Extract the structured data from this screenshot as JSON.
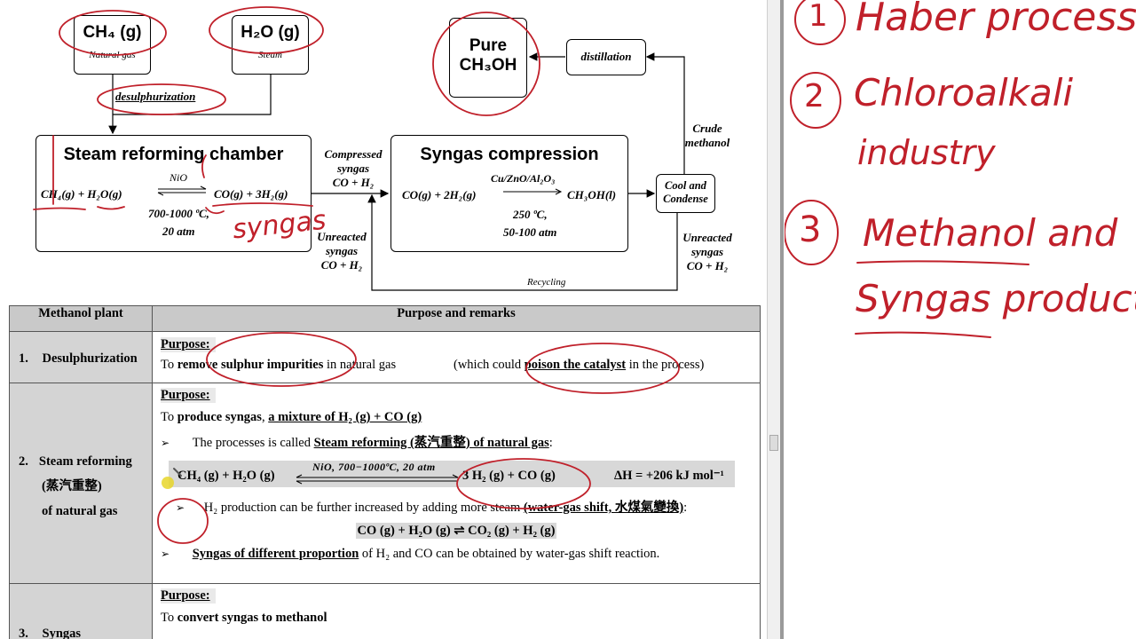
{
  "diagram": {
    "ch4_formula": "CH₄ (g)",
    "ch4_sub": "Natural gas",
    "h2o_formula": "H₂O (g)",
    "h2o_sub": "Steam",
    "desulph": "desulphurization",
    "steam_title": "Steam reforming chamber",
    "steam_catalyst": "NiO",
    "steam_left": "CH₄(g) + H₂O(g)",
    "steam_right": "CO(g) + 3H₂(g)",
    "steam_cond1": "700-1000 ºC,",
    "steam_cond2": "20 atm",
    "compressed1": "Compressed",
    "compressed2": "syngas",
    "compressed3": "CO + H₂",
    "unreacted_l1": "Unreacted",
    "unreacted_l2": "syngas",
    "unreacted_l3": "CO + H₂",
    "syngas_title": "Syngas compression",
    "syngas_catalyst": "Cu/ZnO/Al₂O₃",
    "syngas_left": "CO(g) + 2H₂(g)",
    "syngas_right": "CH₃OH(l)",
    "syngas_cond1": "250 ºC,",
    "syngas_cond2": "50-100 atm",
    "pure1": "Pure",
    "pure2": "CH₃OH",
    "distillation": "distillation",
    "crude1": "Crude",
    "crude2": "methanol",
    "cool1": "Cool and",
    "cool2": "Condense",
    "unreacted_r1": "Unreacted",
    "unreacted_r2": "syngas",
    "unreacted_r3": "CO + H₂",
    "recycling": "Recycling"
  },
  "table": {
    "head_left": "Methanol plant",
    "head_right": "Purpose and remarks",
    "r1_num": "1.",
    "r1_name": "Desulphurization",
    "r1_purpose": "Purpose:",
    "r1_to": "To ",
    "r1_bold": "remove sulphur impurities",
    "r1_rest": " in natural gas",
    "r1_paren_a": "(which could ",
    "r1_paren_b": "poison the catalyst",
    "r1_paren_c": " in the process)",
    "r2_num": "2.",
    "r2_name1": "Steam reforming",
    "r2_name2": "(蒸汽重整)",
    "r2_name3": "of natural gas",
    "r2_purpose": "Purpose:",
    "r2_to": "To ",
    "r2_bold1": "produce syngas",
    "r2_comma": ", ",
    "r2_bold2": "a mixture of H₂ (g) + CO (g)",
    "r2_b1_pre": "The processes is called ",
    "r2_b1_bold": "Steam reforming (蒸汽重整) of natural gas",
    "r2_b1_post": ":",
    "r2_eq_left": "CH₄ (g) + H₂O (g)",
    "r2_eq_cond": "NiO,  700−1000ºC,  20 atm",
    "r2_eq_right": "3 H₂ (g) + CO (g)",
    "r2_eq_dh": "ΔH = +206 kJ mol⁻¹",
    "r2_b2_pre": "H₂ production can be further increased by adding more steam ",
    "r2_b2_bold": "(water-gas shift, 水煤氣變換)",
    "r2_b2_post": ":",
    "r2_wgs": "CO (g) + H₂O (g) ⇌ CO₂ (g) + H₂ (g)",
    "r2_b3_bold": "Syngas of different proportion",
    "r2_b3_post": " of H₂ and CO can be obtained by water-gas shift reaction.",
    "r3_num": "3.",
    "r3_name": "Syngas",
    "r3_purpose": "Purpose:",
    "r3_to": "To ",
    "r3_bold": "convert syngas to methanol"
  },
  "handwriting": {
    "annot_syngas": "syngas",
    "n1_num": "1",
    "n1_text": "Haber process",
    "n2_num": "2",
    "n2_text1": "Chloroalkali",
    "n2_text2": "industry",
    "n3_num": "3",
    "n3_text1": "Methanol and",
    "n3_text2": "Syngas production"
  },
  "colors": {
    "ink_red": "#c0202a",
    "table_header": "#c9c9c9",
    "divider": "#9a9a9a"
  }
}
